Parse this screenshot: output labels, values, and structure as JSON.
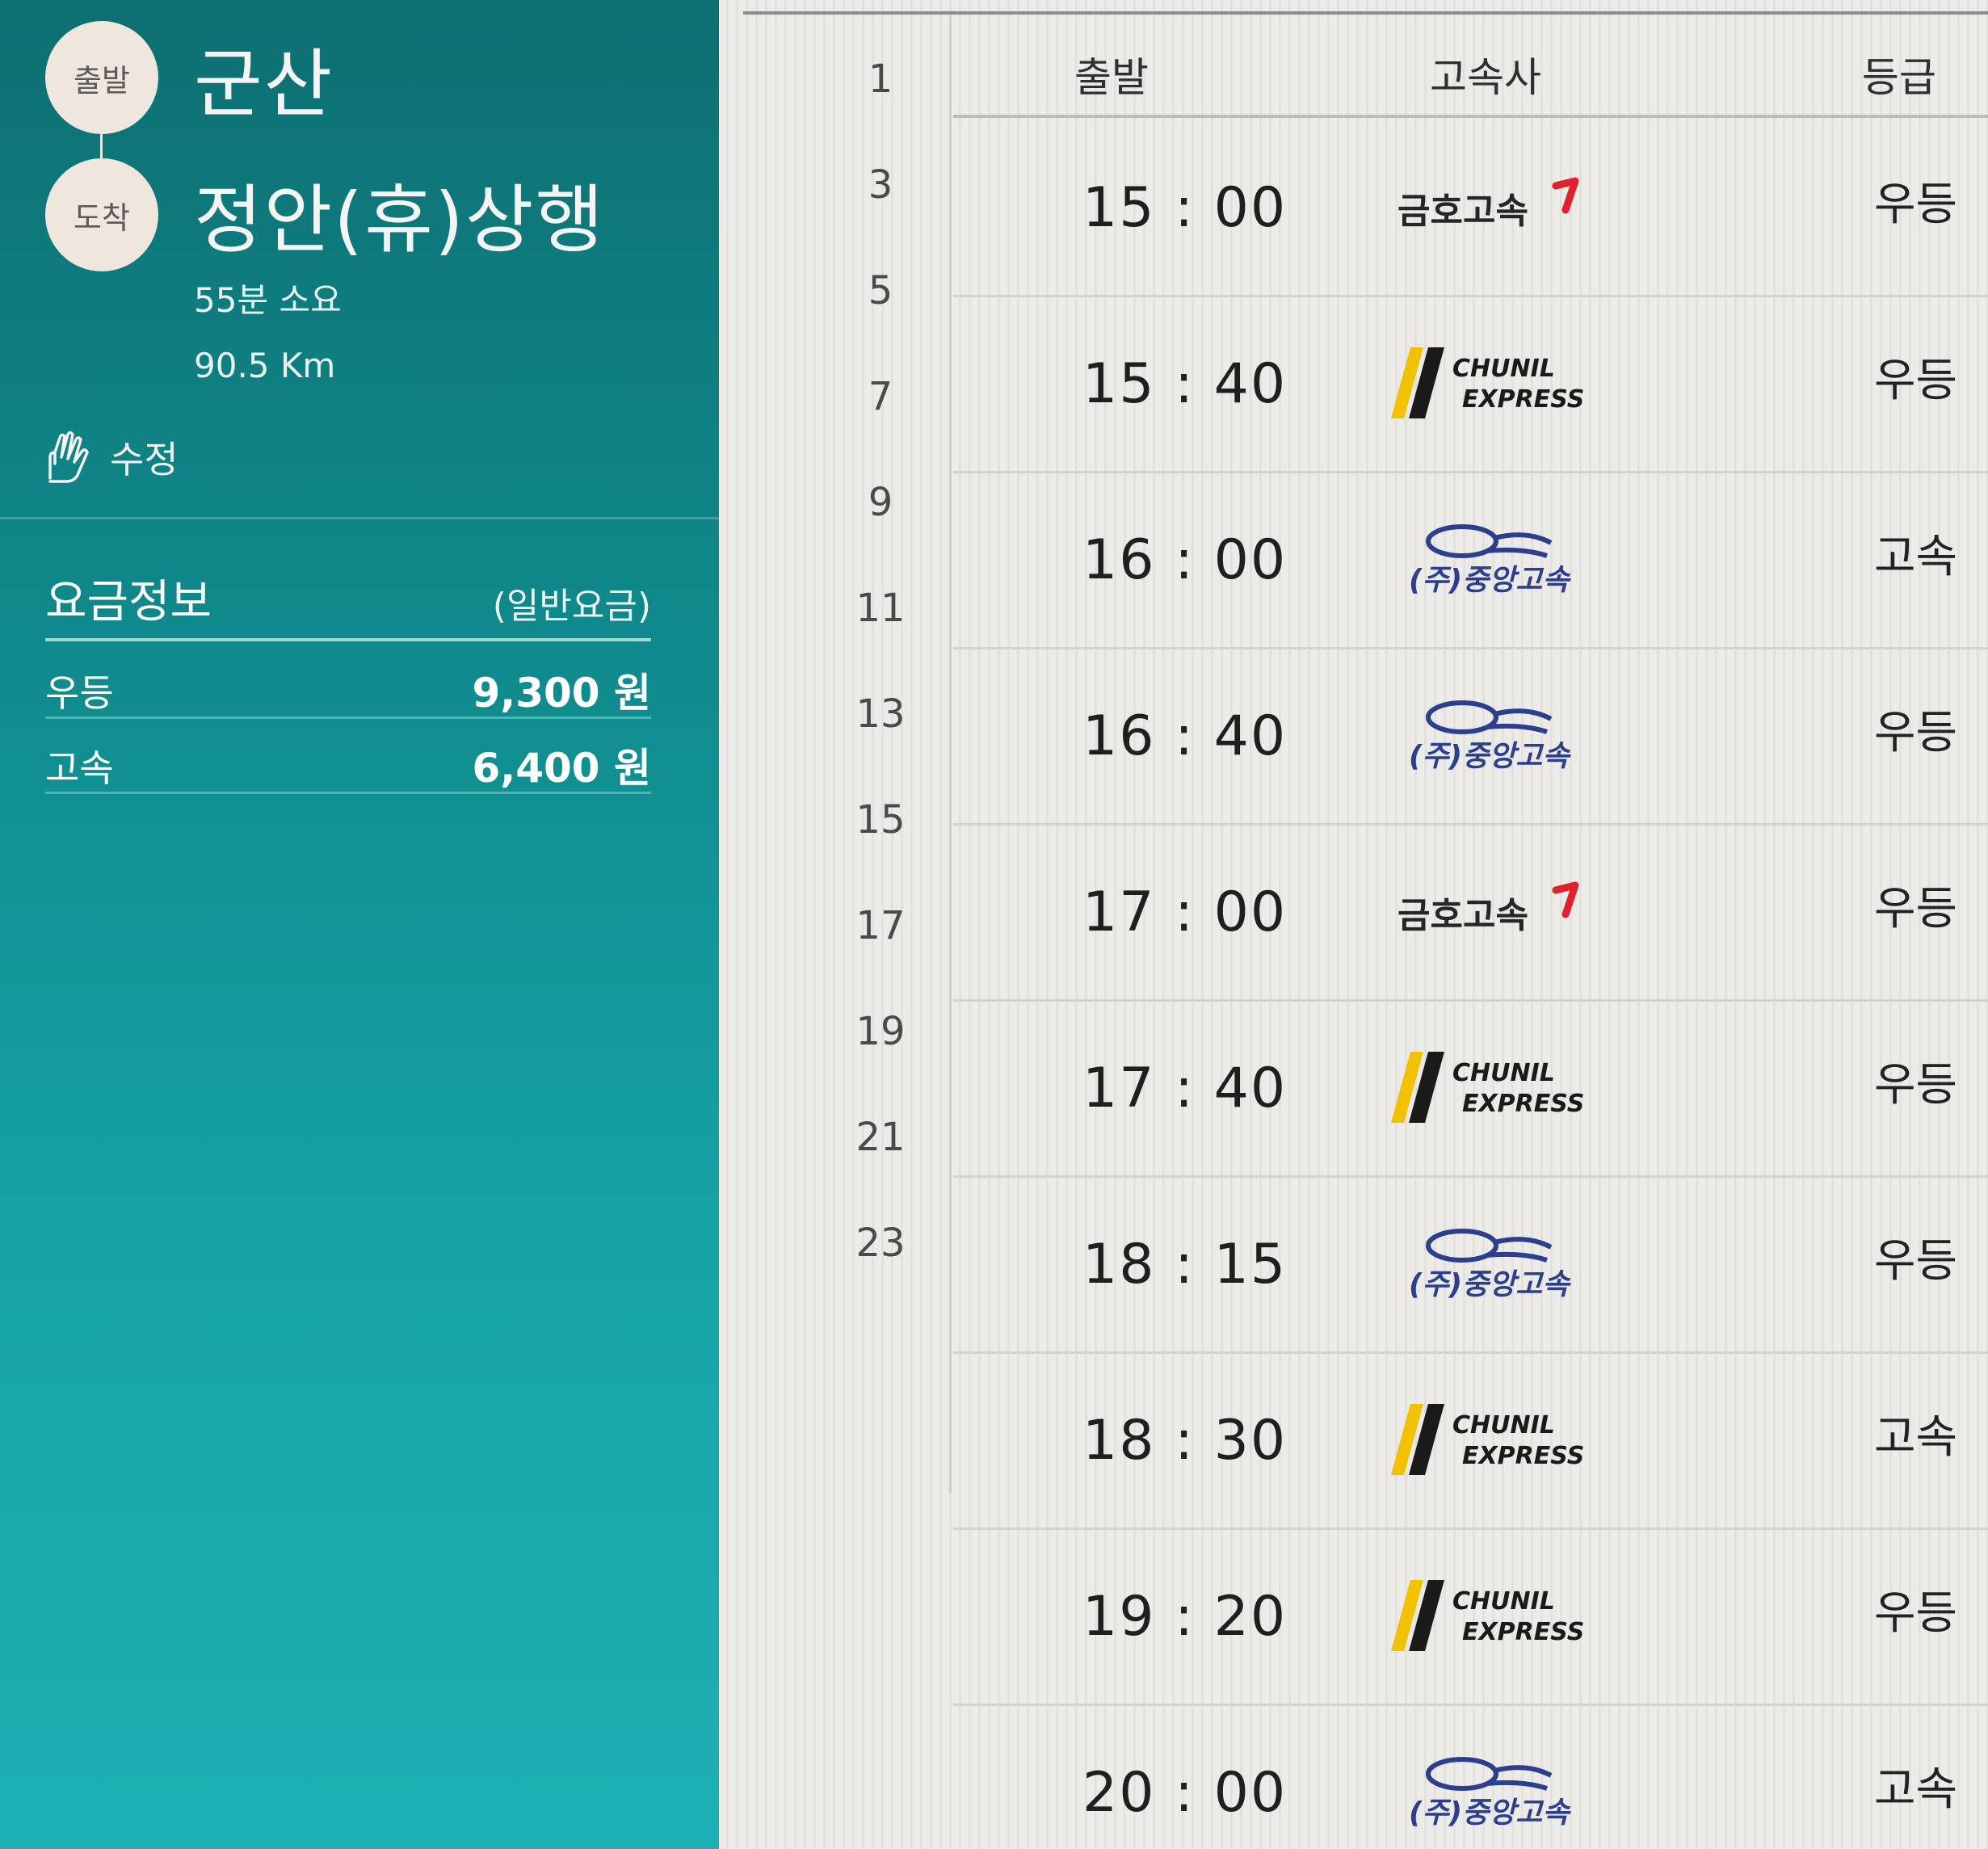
{
  "route": {
    "depart_badge": "출발",
    "depart_name": "군산",
    "arrive_badge": "도착",
    "arrive_name": "정안(휴)상행",
    "duration": "55분 소요",
    "distance": "90.5 Km",
    "edit_label": "수정"
  },
  "fare": {
    "title": "요금정보",
    "type": "(일반요금)",
    "rows": [
      {
        "class": "우등",
        "price": "9,300 원"
      },
      {
        "class": "고속",
        "price": "6,400 원"
      }
    ]
  },
  "row_numbers": [
    "1",
    "3",
    "5",
    "7",
    "9",
    "11",
    "13",
    "15",
    "17",
    "19",
    "21",
    "23"
  ],
  "table": {
    "headers": {
      "depart": "출발",
      "company": "고속사",
      "grade": "등급"
    },
    "rows": [
      {
        "time": "15 : 00",
        "company_logo": "금호고속",
        "grade": "우등"
      },
      {
        "time": "15 : 40",
        "company_logo": "CHUNIL EXPRESS",
        "grade": "우등"
      },
      {
        "time": "16 : 00",
        "company_logo": "(주)중앙고속",
        "grade": "고속"
      },
      {
        "time": "16 : 40",
        "company_logo": "(주)중앙고속",
        "grade": "우등"
      },
      {
        "time": "17 : 00",
        "company_logo": "금호고속",
        "grade": "우등"
      },
      {
        "time": "17 : 40",
        "company_logo": "CHUNIL EXPRESS",
        "grade": "우등"
      },
      {
        "time": "18 : 15",
        "company_logo": "(주)중앙고속",
        "grade": "우등"
      },
      {
        "time": "18 : 30",
        "company_logo": "CHUNIL EXPRESS",
        "grade": "고속"
      },
      {
        "time": "19 : 20",
        "company_logo": "CHUNIL EXPRESS",
        "grade": "우등"
      },
      {
        "time": "20 : 00",
        "company_logo": "(주)중앙고속",
        "grade": "고속"
      }
    ]
  },
  "colors": {
    "panel_teal": "#0f8a8c",
    "badge_bg": "#efe6de",
    "kumho_red": "#e0202a",
    "chunil_yellow": "#f2c200",
    "joongang_blue": "#2c3f8f"
  }
}
